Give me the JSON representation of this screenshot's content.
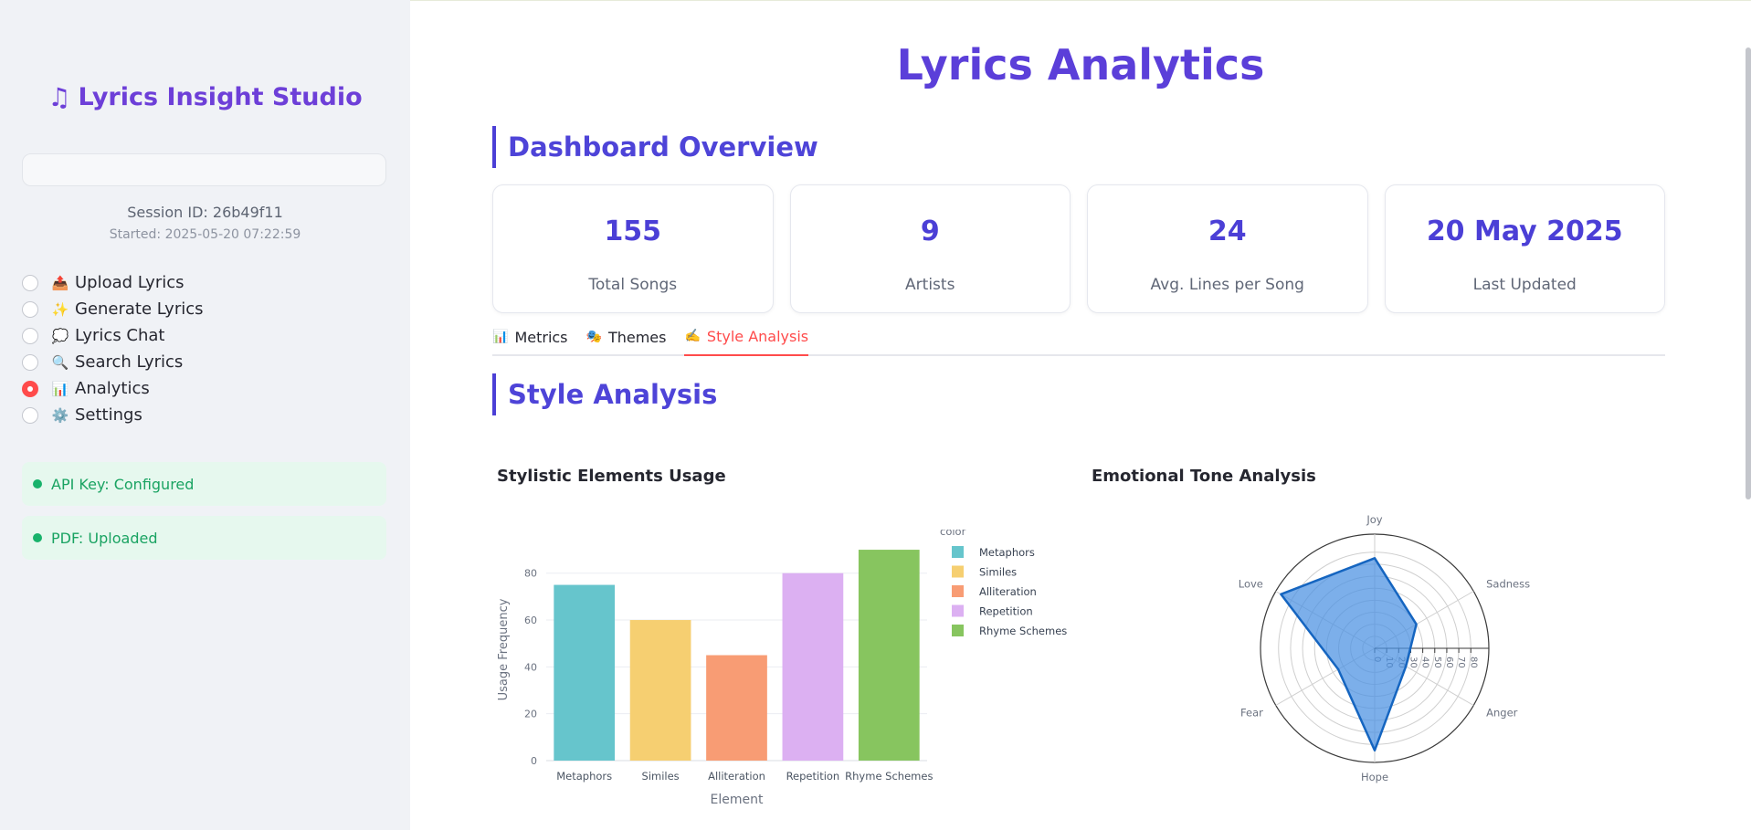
{
  "sidebar": {
    "title": "Lyrics Insight Studio",
    "session_id": "Session ID: 26b49f11",
    "started": "Started: 2025-05-20 07:22:59",
    "nav": [
      {
        "icon": "📤",
        "label": "Upload Lyrics",
        "selected": false
      },
      {
        "icon": "✨",
        "label": "Generate Lyrics",
        "selected": false
      },
      {
        "icon": "💭",
        "label": "Lyrics Chat",
        "selected": false
      },
      {
        "icon": "🔍",
        "label": "Search Lyrics",
        "selected": false
      },
      {
        "icon": "📊",
        "label": "Analytics",
        "selected": true
      },
      {
        "icon": "⚙️",
        "label": "Settings",
        "selected": false
      }
    ],
    "status": [
      {
        "label": "API Key: Configured"
      },
      {
        "label": "PDF: Uploaded"
      }
    ]
  },
  "main": {
    "title": "Lyrics Analytics",
    "overview_heading": "Dashboard Overview",
    "cards": [
      {
        "value": "155",
        "label": "Total Songs"
      },
      {
        "value": "9",
        "label": "Artists"
      },
      {
        "value": "24",
        "label": "Avg. Lines per Song"
      },
      {
        "value": "20 May 2025",
        "label": "Last Updated"
      }
    ],
    "tabs": [
      {
        "icon": "📊",
        "label": "Metrics",
        "active": false
      },
      {
        "icon": "🎭",
        "label": "Themes",
        "active": false
      },
      {
        "icon": "✍️",
        "label": "Style Analysis",
        "active": true
      }
    ],
    "style_heading": "Style Analysis"
  },
  "colors": {
    "accent": "#4b3fd6",
    "brand": "#6d3fd8",
    "active_tab": "#ff4b4b",
    "status_green": "#1aa362"
  },
  "chart_data": [
    {
      "type": "bar",
      "title": "Stylistic Elements Usage",
      "categories": [
        "Metaphors",
        "Similes",
        "Alliteration",
        "Repetition",
        "Rhyme Schemes"
      ],
      "values": [
        75,
        60,
        45,
        80,
        90
      ],
      "colors": [
        "#66c5cc",
        "#f6cf71",
        "#f89c74",
        "#dcb0f2",
        "#87c55f"
      ],
      "xlabel": "Element",
      "ylabel": "Usage Frequency",
      "yticks": [
        0,
        20,
        40,
        60,
        80
      ],
      "ylim": [
        0,
        94.7
      ],
      "legend_title": "color",
      "legend_placement": "right",
      "grid": true
    },
    {
      "type": "radar",
      "title": "Emotional Tone Analysis",
      "categories": [
        "Joy",
        "Sadness",
        "Anger",
        "Hope",
        "Fear",
        "Love"
      ],
      "values": [
        75,
        40,
        30,
        85,
        35,
        90
      ],
      "radial_ticks": [
        0,
        10,
        20,
        30,
        40,
        50,
        60,
        70,
        80
      ],
      "range": [
        0,
        95
      ],
      "fill_color": "#4a90e2",
      "line_color": "#1565c0"
    }
  ]
}
